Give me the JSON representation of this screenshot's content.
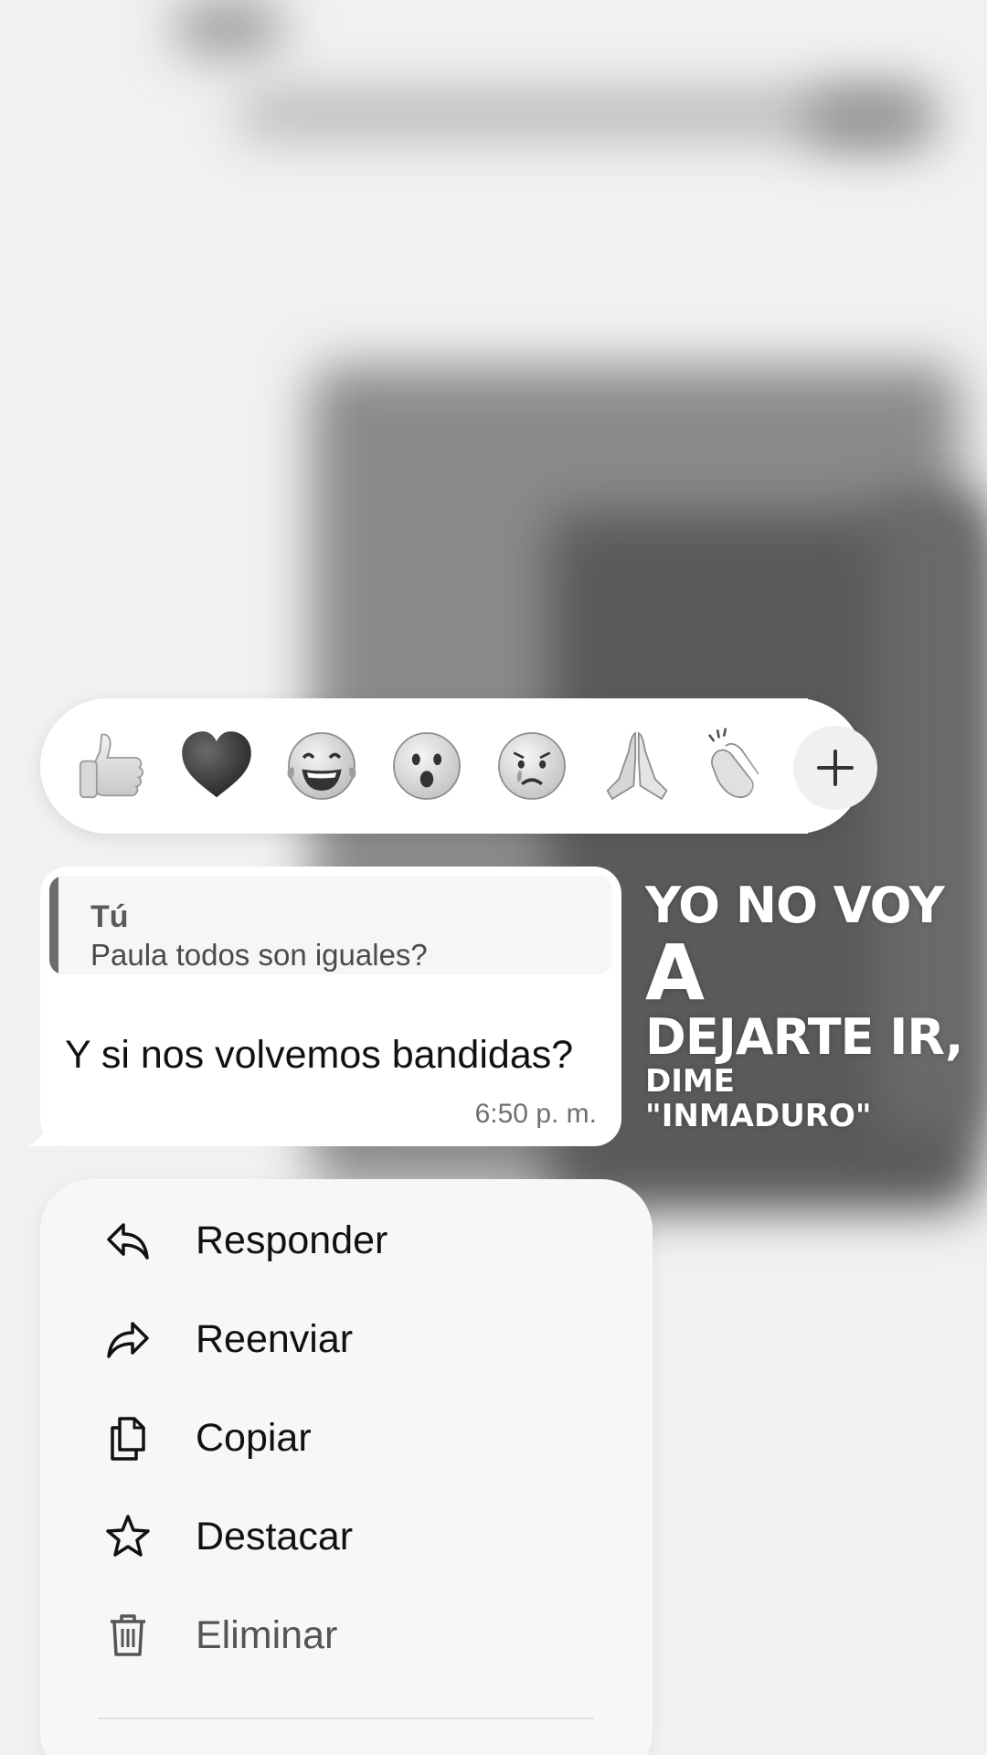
{
  "reactions": {
    "items": [
      {
        "name": "thumbs-up",
        "glyph": "👍"
      },
      {
        "name": "heart",
        "glyph": "🖤"
      },
      {
        "name": "tears-of-joy",
        "glyph": "😂"
      },
      {
        "name": "surprised",
        "glyph": "😮"
      },
      {
        "name": "crying",
        "glyph": "😢"
      },
      {
        "name": "praying-hands",
        "glyph": "🙏"
      },
      {
        "name": "clapping",
        "glyph": "👏"
      }
    ],
    "more_icon": "plus-icon"
  },
  "message": {
    "quote_author": "Tú",
    "quote_text": "Paula todos son iguales?",
    "text": "Y si nos volvemos bandidas?",
    "time": "6:50 p. m."
  },
  "overlay": {
    "line1": "YO NO VOY",
    "line2": "A",
    "line3": "DEJARTE IR,",
    "line4": "DIME",
    "line5": "\"INMADURO\""
  },
  "menu": {
    "reply": {
      "label": "Responder",
      "icon": "reply-icon"
    },
    "forward": {
      "label": "Reenviar",
      "icon": "forward-icon"
    },
    "copy": {
      "label": "Copiar",
      "icon": "copy-icon"
    },
    "star": {
      "label": "Destacar",
      "icon": "star-icon"
    },
    "delete": {
      "label": "Eliminar",
      "icon": "trash-icon"
    }
  },
  "colors": {
    "background": "#f1f1f1",
    "bubble": "#ffffff",
    "menu": "#f7f7f7",
    "quote_bar": "#6c6c6c"
  }
}
